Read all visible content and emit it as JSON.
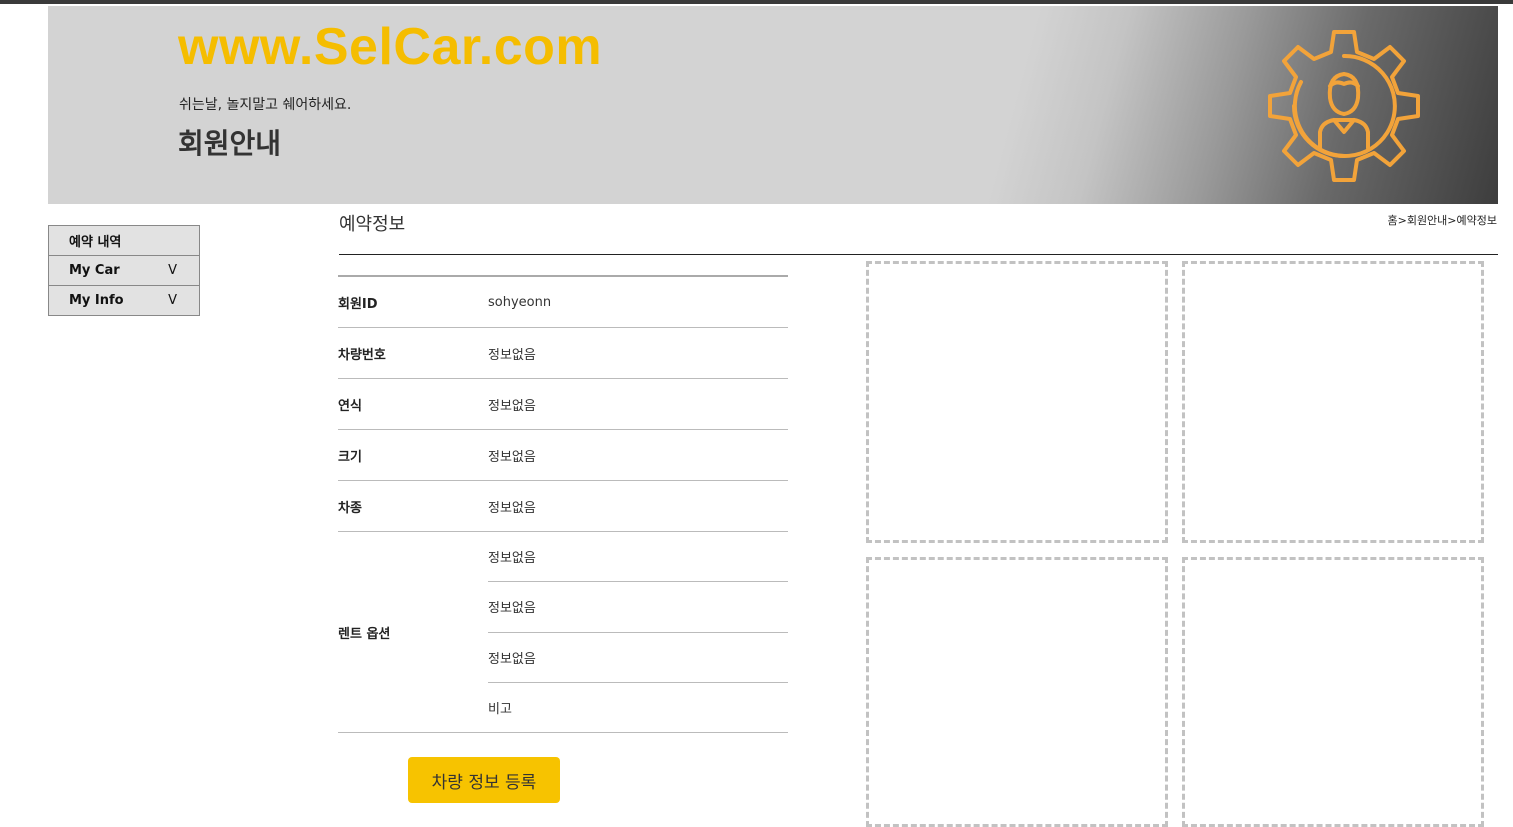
{
  "header": {
    "site_title": "www.SelCar.com",
    "slogan": "쉬는날, 놀지말고 쉐어하세요.",
    "page_heading": "회원안내",
    "icon": "gear-person-icon",
    "accent_color": "#f5bd00"
  },
  "sidebar": {
    "items": [
      {
        "label": "예약 내역",
        "icon": ""
      },
      {
        "label": "My Car",
        "icon": "chevron-down-icon",
        "chevron": "V"
      },
      {
        "label": "My Info",
        "icon": "chevron-down-icon",
        "chevron": "V"
      }
    ]
  },
  "main": {
    "section_title": "예약정보",
    "breadcrumb": "홈>회원안내>예약정보",
    "rows": [
      {
        "label": "회원ID",
        "value": "sohyeonn"
      },
      {
        "label": "차량번호",
        "value": "정보없음"
      },
      {
        "label": "연식",
        "value": "정보없음"
      },
      {
        "label": "크기",
        "value": "정보없음"
      },
      {
        "label": "차종",
        "value": "정보없음"
      }
    ],
    "options": {
      "label": "렌트 옵션",
      "values": [
        "정보없음",
        "정보없음",
        "정보없음",
        "비고"
      ]
    },
    "register_button": "차량 정보 등록",
    "button_color": "#f7c300"
  }
}
